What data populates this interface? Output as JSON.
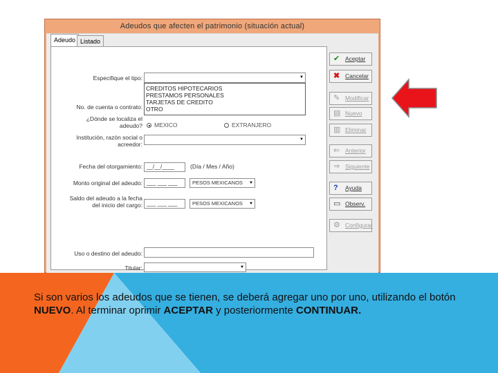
{
  "window": {
    "title": "Adeudos que afecten el patrimonio (situación actual)"
  },
  "tabs": [
    {
      "label": "Adeudo",
      "active": true
    },
    {
      "label": "Listado",
      "active": false
    }
  ],
  "form": {
    "tipo_label": "Especifique el tipo:",
    "tipo_options": [
      "CREDITOS HIPOTECARIOS",
      "PRESTAMOS PERSONALES",
      "TARJETAS DE CREDITO",
      "OTRO"
    ],
    "cuenta_label": "No. de cuenta o contrato:",
    "localiza_label_1": "¿Dónde se localiza el",
    "localiza_label_2": "adeudo?",
    "radio_mexico": "MEXICO",
    "radio_extranjero": "EXTRANJERO",
    "radio_selected": "MEXICO",
    "institucion_label_1": "Institución, razón social o",
    "institucion_label_2": "acreedor:",
    "fecha_label": "Fecha del otorgamiento:",
    "fecha_value": "__/__/____",
    "fecha_hint": "(Día / Mes / Año)",
    "monto_label": "Monto original del adeudo:",
    "monto_value": "___ ___ ___",
    "monto_moneda": "PESOS MEXICANOS",
    "saldo_label_1": "Saldo del adeudo a la fecha",
    "saldo_label_2": "del inicio del cargo:",
    "saldo_value": "___ ___ ___",
    "saldo_moneda": "PESOS MEXICANOS",
    "uso_label": "Uso o destino del adeudo:",
    "titular_label": "Titular:"
  },
  "buttons": [
    {
      "label": "Aceptar",
      "icon": "check-icon",
      "enabled": true
    },
    {
      "label": "Cancelar",
      "icon": "x-icon",
      "enabled": true
    },
    {
      "label": "Modificar",
      "icon": "edit-icon",
      "enabled": false
    },
    {
      "label": "Nuevo",
      "icon": "new-icon",
      "enabled": false
    },
    {
      "label": "Eliminar",
      "icon": "trash-icon",
      "enabled": false
    },
    {
      "label": "Anterior",
      "icon": "left-arrow-icon",
      "enabled": false
    },
    {
      "label": "Siguiente",
      "icon": "right-arrow-icon",
      "enabled": false
    },
    {
      "label": "Ayuda",
      "icon": "help-icon",
      "enabled": true
    },
    {
      "label": "Observ.",
      "icon": "notes-icon",
      "enabled": true
    },
    {
      "label": "Configurar",
      "icon": "config-icon",
      "enabled": false
    }
  ],
  "caption": {
    "part1": "Si son varios los adeudos que se tienen, se deberá agregar uno por uno, utilizando el botón ",
    "bold1": "NUEVO",
    "part2": ". Al terminar oprimir ",
    "bold2": "ACEPTAR",
    "part3": " y posteriormente ",
    "bold3": "CONTINUAR."
  },
  "colors": {
    "window_frame": "#f0a77a",
    "arrow": "#e8141a",
    "bg_blue": "#35aee0",
    "bg_orange": "#f4661f"
  }
}
